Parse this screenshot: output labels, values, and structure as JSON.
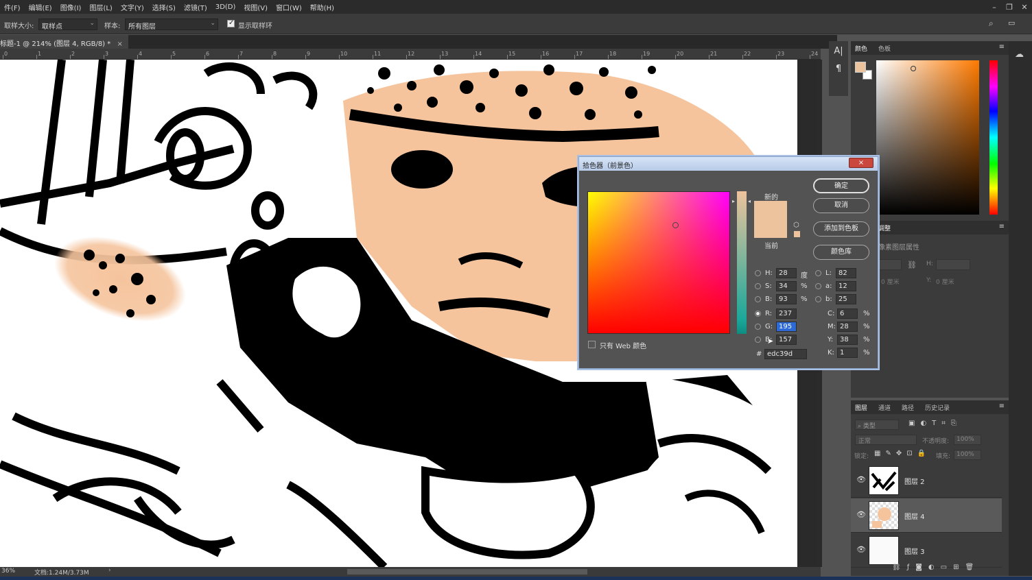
{
  "menu": [
    "件(F)",
    "编辑(E)",
    "图像(I)",
    "图层(L)",
    "文字(Y)",
    "选择(S)",
    "滤镜(T)",
    "3D(D)",
    "视图(V)",
    "窗口(W)",
    "帮助(H)"
  ],
  "options": {
    "sample_size_label": "取样大小:",
    "sample_size_value": "取样点",
    "sample_label": "样本:",
    "sample_value": "所有图层",
    "show_ring_label": "显示取样环"
  },
  "document": {
    "tab_title": "标题-1 @ 214% (图层 4, RGB/8) *",
    "close": "×"
  },
  "ruler_ticks": [
    "0",
    "1",
    "2",
    "3",
    "4",
    "5",
    "6",
    "7",
    "8",
    "9",
    "10",
    "11",
    "12",
    "13",
    "14",
    "15",
    "16",
    "17",
    "18",
    "19",
    "20",
    "21",
    "22",
    "23",
    "24"
  ],
  "status": {
    "zoom": "36%",
    "doc": "文档:1.24M/3.73M"
  },
  "tools": {
    "type": "A|",
    "para": "¶"
  },
  "color_panel": {
    "tab1": "颜色",
    "tab2": "色板",
    "fg_color": "#edc39d",
    "bg_color": "#ffffff",
    "hue_color": "#ff7a00"
  },
  "props_panel": {
    "tab": "调整",
    "title": "像素图层属性",
    "h_label": "H:",
    "w_unit": "0 厘米",
    "y_label": "Y:",
    "y_value": "0 厘米"
  },
  "layers_panel": {
    "tabs": [
      "图层",
      "通道",
      "路径",
      "历史记录"
    ],
    "filter_label": "类型",
    "blend_mode": "正常",
    "opacity_label": "不透明度:",
    "opacity_value": "100%",
    "lock_label": "锁定:",
    "fill_label": "填充:",
    "fill_value": "100%",
    "layers": [
      {
        "name": "图层 2"
      },
      {
        "name": "图层 4"
      },
      {
        "name": "图层 3"
      }
    ]
  },
  "picker": {
    "title": "拾色器（前景色）",
    "close": "×",
    "ok": "确定",
    "cancel": "取消",
    "add_swatch": "添加到色板",
    "libraries": "颜色库",
    "new_label": "新的",
    "current_label": "当前",
    "web_only": "只有 Web 颜色",
    "new_color": "#edc39d",
    "current_color": "#edc39d",
    "hsb": {
      "H": "28",
      "H_unit": "度",
      "S": "34",
      "S_unit": "%",
      "B": "93",
      "B_unit": "%"
    },
    "rgb": {
      "R": "237",
      "G": "195",
      "B": "157"
    },
    "lab": {
      "L": "82",
      "a": "12",
      "b": "25"
    },
    "cmyk": {
      "C": "6",
      "M": "28",
      "Y": "38",
      "K": "1",
      "unit": "%"
    },
    "hex_label": "#",
    "hex": "edc39d"
  }
}
